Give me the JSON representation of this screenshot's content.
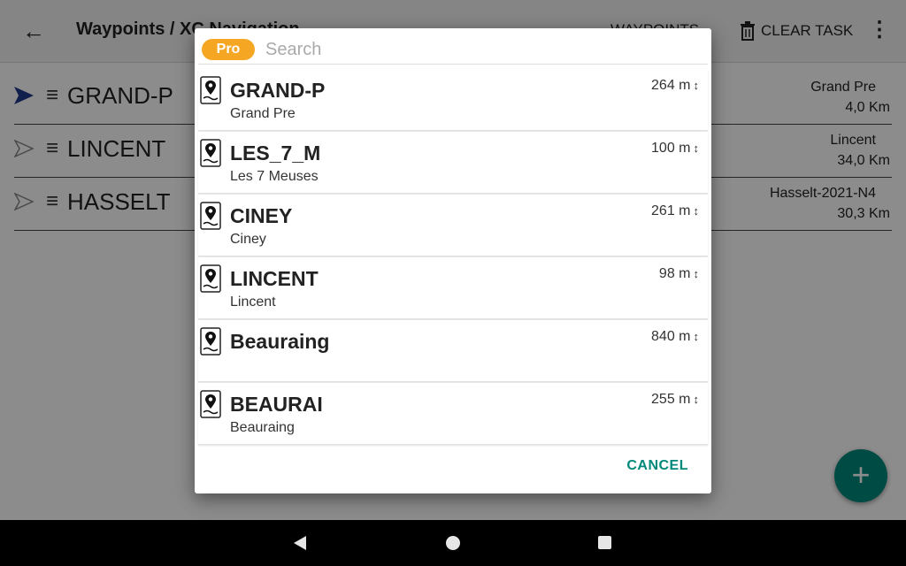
{
  "header": {
    "back_icon": "arrow-left-icon",
    "title": "Waypoints / XC Navigation",
    "waypoints_action": "WAYPOINTS",
    "clear_task_label": "CLEAR TASK",
    "clear_task_icon": "trash-icon",
    "more_icon": "more-vert-icon"
  },
  "task": [
    {
      "code": "GRAND-P",
      "name": "Grand Pre",
      "distance": "4,0 Km",
      "active": true
    },
    {
      "code": "LINCENT",
      "name": "Lincent",
      "distance": "34,0 Km",
      "active": false
    },
    {
      "code": "HASSELT",
      "name": "Hasselt-2021-N4",
      "distance": "30,3 Km",
      "active": false
    }
  ],
  "dialog": {
    "pro_badge": "Pro",
    "search_placeholder": "Search",
    "search_value": "",
    "waypoints": [
      {
        "code": "GRAND-P",
        "name": "Grand Pre",
        "elevation": "264 m"
      },
      {
        "code": "LES_7_M",
        "name": "Les 7 Meuses",
        "elevation": "100 m"
      },
      {
        "code": "CINEY",
        "name": "Ciney",
        "elevation": "261 m"
      },
      {
        "code": "LINCENT",
        "name": "Lincent",
        "elevation": "98 m"
      },
      {
        "code": "Beauraing",
        "name": "",
        "elevation": "840 m"
      },
      {
        "code": "BEAURAI",
        "name": "Beauraing",
        "elevation": "255 m"
      }
    ],
    "cancel_label": "CANCEL"
  },
  "fab": {
    "icon": "plus-icon"
  },
  "nav": {
    "back_icon": "nav-back-icon",
    "home_icon": "nav-home-icon",
    "recent_icon": "nav-recent-icon"
  },
  "colors": {
    "accent": "#00897b",
    "pro": "#f5a623",
    "active_arrow": "#1e3a8a"
  }
}
